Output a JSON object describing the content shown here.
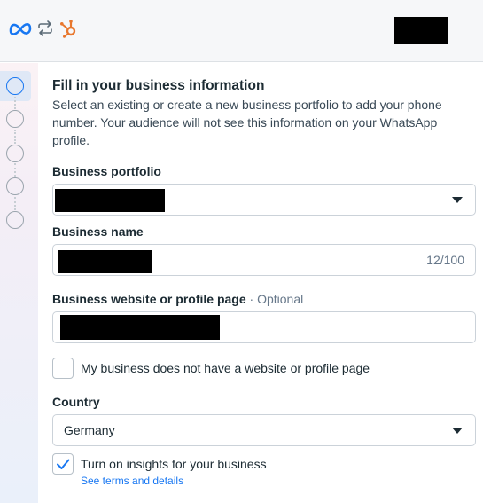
{
  "header": {
    "icons": [
      "meta-logo-icon",
      "sync-arrows-icon",
      "hubspot-logo-icon"
    ]
  },
  "stepper": {
    "steps": 5,
    "active_step": 1
  },
  "form": {
    "title": "Fill in your business information",
    "description": "Select an existing or create a new business portfolio to add your phone number. Your audience will not see this information on your WhatsApp profile.",
    "business_portfolio": {
      "label": "Business portfolio"
    },
    "business_name": {
      "label": "Business name",
      "counter": "12/100"
    },
    "website": {
      "label": "Business website or profile page",
      "optional": " · Optional"
    },
    "no_website_checkbox": {
      "label": "My business does not have a website or profile page",
      "checked": false
    },
    "country": {
      "label": "Country",
      "value": "Germany"
    },
    "insights_checkbox": {
      "label": "Turn on insights for your business",
      "checked": true,
      "link": "See terms and details"
    }
  },
  "colors": {
    "accent": "#1877f2",
    "hubspot": "#e8772e",
    "text": "#1c2b33",
    "muted": "#67788a"
  }
}
